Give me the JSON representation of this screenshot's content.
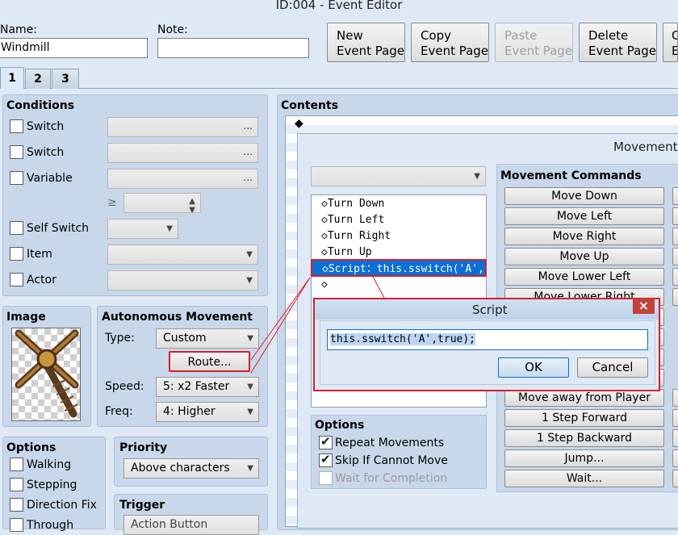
{
  "window": {
    "title": "ID:004 - Event Editor"
  },
  "header": {
    "name_label": "Name:",
    "name_value": "Windmill",
    "note_label": "Note:",
    "note_value": "",
    "buttons": [
      {
        "line1": "New",
        "line2": "Event Page"
      },
      {
        "line1": "Copy",
        "line2": "Event Page"
      },
      {
        "line1": "Paste",
        "line2": "Event Page"
      },
      {
        "line1": "Delete",
        "line2": "Event Page"
      },
      {
        "line1": "C",
        "line2": "E"
      }
    ]
  },
  "tabs": [
    "1",
    "2",
    "3"
  ],
  "conditions": {
    "title": "Conditions",
    "items": [
      "Switch",
      "Switch",
      "Variable",
      "Self Switch",
      "Item",
      "Actor"
    ],
    "gte_symbol": "≥",
    "dots": "..."
  },
  "image": {
    "title": "Image"
  },
  "autonomous": {
    "title": "Autonomous Movement",
    "type_label": "Type:",
    "type_value": "Custom",
    "route_label": "Route...",
    "speed_label": "Speed:",
    "speed_value": "5: x2 Faster",
    "freq_label": "Freq:",
    "freq_value": "4: Higher"
  },
  "options": {
    "title": "Options",
    "items": [
      "Walking",
      "Stepping",
      "Direction Fix",
      "Through"
    ]
  },
  "priority": {
    "title": "Priority",
    "value": "Above characters"
  },
  "trigger": {
    "title": "Trigger",
    "value": "Action Button"
  },
  "contents": {
    "title": "Contents",
    "first_item": "◆"
  },
  "movement_route": {
    "title": "Movement R",
    "list": [
      "◇Turn Down",
      "◇Turn Left",
      "◇Turn Right",
      "◇Turn Up",
      "◇Script：this.sswitch('A',t…",
      "◇"
    ],
    "commands_title": "Movement Commands",
    "commands": [
      "Move Down",
      "Move Left",
      "Move Right",
      "Move Up",
      "Move Lower Left",
      "Move Lower Right",
      "Move away from Player",
      "1 Step Forward",
      "1 Step Backward",
      "Jump...",
      "Wait..."
    ],
    "options_title": "Options",
    "options": [
      {
        "label": "Repeat Movements",
        "checked": true
      },
      {
        "label": "Skip If Cannot Move",
        "checked": true
      },
      {
        "label": "Wait for Completion",
        "checked": false
      }
    ]
  },
  "script_dialog": {
    "title": "Script",
    "close": "×",
    "value": "this.sswitch('A',true);",
    "ok": "OK",
    "cancel": "Cancel"
  },
  "colors": {
    "accent": "#0a6fd6",
    "highlight": "#d8202a",
    "panel": "#c8d8ea",
    "background": "#dfe9f5"
  }
}
